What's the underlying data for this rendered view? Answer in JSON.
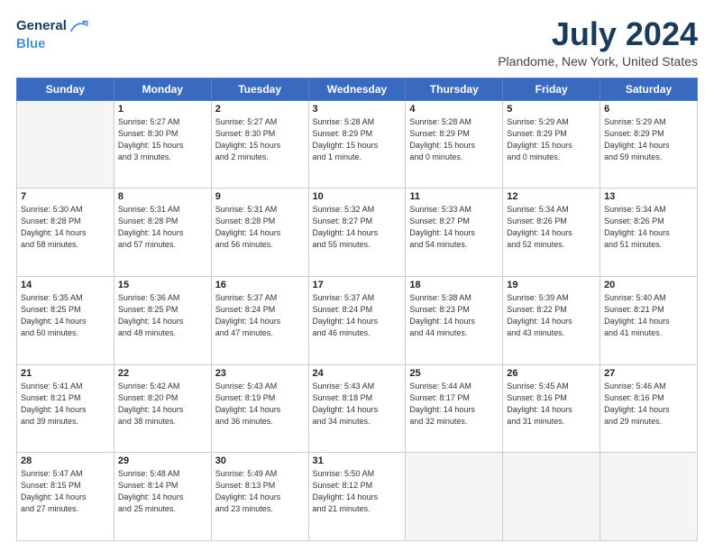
{
  "header": {
    "logo_line1": "General",
    "logo_line2": "Blue",
    "title": "July 2024",
    "subtitle": "Plandome, New York, United States"
  },
  "days_of_week": [
    "Sunday",
    "Monday",
    "Tuesday",
    "Wednesday",
    "Thursday",
    "Friday",
    "Saturday"
  ],
  "weeks": [
    [
      {
        "day": "",
        "info": ""
      },
      {
        "day": "1",
        "info": "Sunrise: 5:27 AM\nSunset: 8:30 PM\nDaylight: 15 hours\nand 3 minutes."
      },
      {
        "day": "2",
        "info": "Sunrise: 5:27 AM\nSunset: 8:30 PM\nDaylight: 15 hours\nand 2 minutes."
      },
      {
        "day": "3",
        "info": "Sunrise: 5:28 AM\nSunset: 8:29 PM\nDaylight: 15 hours\nand 1 minute."
      },
      {
        "day": "4",
        "info": "Sunrise: 5:28 AM\nSunset: 8:29 PM\nDaylight: 15 hours\nand 0 minutes."
      },
      {
        "day": "5",
        "info": "Sunrise: 5:29 AM\nSunset: 8:29 PM\nDaylight: 15 hours\nand 0 minutes."
      },
      {
        "day": "6",
        "info": "Sunrise: 5:29 AM\nSunset: 8:29 PM\nDaylight: 14 hours\nand 59 minutes."
      }
    ],
    [
      {
        "day": "7",
        "info": "Sunrise: 5:30 AM\nSunset: 8:28 PM\nDaylight: 14 hours\nand 58 minutes."
      },
      {
        "day": "8",
        "info": "Sunrise: 5:31 AM\nSunset: 8:28 PM\nDaylight: 14 hours\nand 57 minutes."
      },
      {
        "day": "9",
        "info": "Sunrise: 5:31 AM\nSunset: 8:28 PM\nDaylight: 14 hours\nand 56 minutes."
      },
      {
        "day": "10",
        "info": "Sunrise: 5:32 AM\nSunset: 8:27 PM\nDaylight: 14 hours\nand 55 minutes."
      },
      {
        "day": "11",
        "info": "Sunrise: 5:33 AM\nSunset: 8:27 PM\nDaylight: 14 hours\nand 54 minutes."
      },
      {
        "day": "12",
        "info": "Sunrise: 5:34 AM\nSunset: 8:26 PM\nDaylight: 14 hours\nand 52 minutes."
      },
      {
        "day": "13",
        "info": "Sunrise: 5:34 AM\nSunset: 8:26 PM\nDaylight: 14 hours\nand 51 minutes."
      }
    ],
    [
      {
        "day": "14",
        "info": "Sunrise: 5:35 AM\nSunset: 8:25 PM\nDaylight: 14 hours\nand 50 minutes."
      },
      {
        "day": "15",
        "info": "Sunrise: 5:36 AM\nSunset: 8:25 PM\nDaylight: 14 hours\nand 48 minutes."
      },
      {
        "day": "16",
        "info": "Sunrise: 5:37 AM\nSunset: 8:24 PM\nDaylight: 14 hours\nand 47 minutes."
      },
      {
        "day": "17",
        "info": "Sunrise: 5:37 AM\nSunset: 8:24 PM\nDaylight: 14 hours\nand 46 minutes."
      },
      {
        "day": "18",
        "info": "Sunrise: 5:38 AM\nSunset: 8:23 PM\nDaylight: 14 hours\nand 44 minutes."
      },
      {
        "day": "19",
        "info": "Sunrise: 5:39 AM\nSunset: 8:22 PM\nDaylight: 14 hours\nand 43 minutes."
      },
      {
        "day": "20",
        "info": "Sunrise: 5:40 AM\nSunset: 8:21 PM\nDaylight: 14 hours\nand 41 minutes."
      }
    ],
    [
      {
        "day": "21",
        "info": "Sunrise: 5:41 AM\nSunset: 8:21 PM\nDaylight: 14 hours\nand 39 minutes."
      },
      {
        "day": "22",
        "info": "Sunrise: 5:42 AM\nSunset: 8:20 PM\nDaylight: 14 hours\nand 38 minutes."
      },
      {
        "day": "23",
        "info": "Sunrise: 5:43 AM\nSunset: 8:19 PM\nDaylight: 14 hours\nand 36 minutes."
      },
      {
        "day": "24",
        "info": "Sunrise: 5:43 AM\nSunset: 8:18 PM\nDaylight: 14 hours\nand 34 minutes."
      },
      {
        "day": "25",
        "info": "Sunrise: 5:44 AM\nSunset: 8:17 PM\nDaylight: 14 hours\nand 32 minutes."
      },
      {
        "day": "26",
        "info": "Sunrise: 5:45 AM\nSunset: 8:16 PM\nDaylight: 14 hours\nand 31 minutes."
      },
      {
        "day": "27",
        "info": "Sunrise: 5:46 AM\nSunset: 8:16 PM\nDaylight: 14 hours\nand 29 minutes."
      }
    ],
    [
      {
        "day": "28",
        "info": "Sunrise: 5:47 AM\nSunset: 8:15 PM\nDaylight: 14 hours\nand 27 minutes."
      },
      {
        "day": "29",
        "info": "Sunrise: 5:48 AM\nSunset: 8:14 PM\nDaylight: 14 hours\nand 25 minutes."
      },
      {
        "day": "30",
        "info": "Sunrise: 5:49 AM\nSunset: 8:13 PM\nDaylight: 14 hours\nand 23 minutes."
      },
      {
        "day": "31",
        "info": "Sunrise: 5:50 AM\nSunset: 8:12 PM\nDaylight: 14 hours\nand 21 minutes."
      },
      {
        "day": "",
        "info": ""
      },
      {
        "day": "",
        "info": ""
      },
      {
        "day": "",
        "info": ""
      }
    ]
  ]
}
